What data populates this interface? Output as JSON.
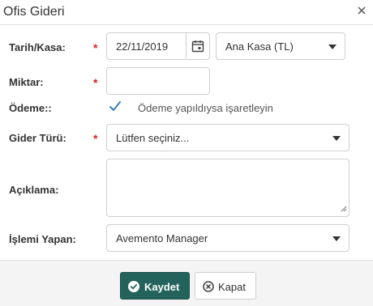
{
  "dialog": {
    "title": "Ofis Gideri",
    "close_icon": "close-icon"
  },
  "form": {
    "date_cash": {
      "label": "Tarih/Kasa:",
      "required": "*",
      "date_value": "22/11/2019",
      "calendar_icon": "calendar-icon",
      "cash_selected": "Ana Kasa (TL)"
    },
    "amount": {
      "label": "Miktar:",
      "required": "*",
      "value": ""
    },
    "payment": {
      "label": "Ödeme::",
      "checkbox_text": "Ödeme yapıldıysa işaretleyin",
      "checked": true
    },
    "expense_type": {
      "label": "Gider Türü:",
      "required": "*",
      "selected": "Lütfen seçiniz..."
    },
    "description": {
      "label": "Açıklama:",
      "value": ""
    },
    "operator": {
      "label": "İşlemi Yapan:",
      "selected": "Avemento Manager"
    }
  },
  "footer": {
    "save_label": "Kaydet",
    "close_label": "Kapat"
  },
  "colors": {
    "save_button": "#23635b",
    "required_mark": "#e02020",
    "checkbox_tick": "#3a7fc4"
  }
}
